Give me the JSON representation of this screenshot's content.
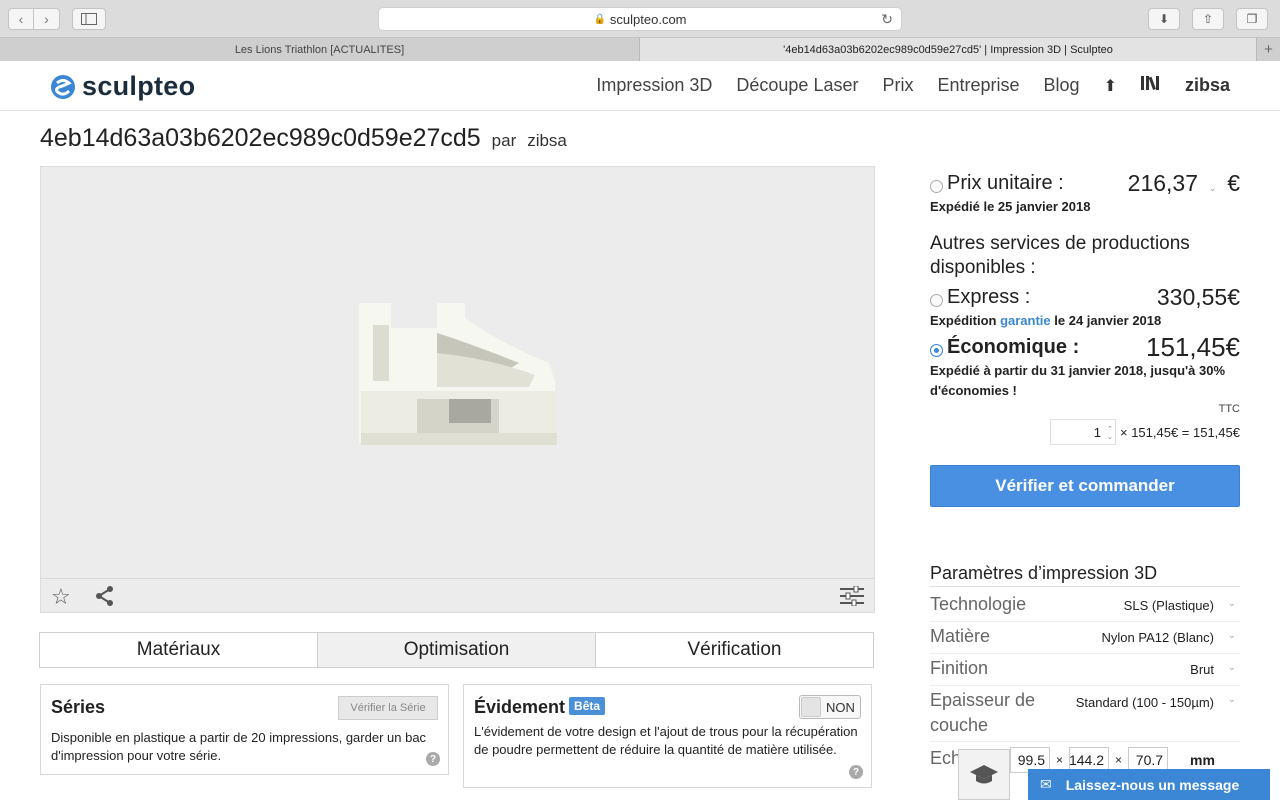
{
  "browser": {
    "url": "sculpteo.com",
    "tabs": [
      {
        "label": "Les Lions Triathlon [ACTUALITES]"
      },
      {
        "label": "'4eb14d63a03b6202ec989c0d59e27cd5' | Impression 3D | Sculpteo"
      }
    ]
  },
  "site": {
    "logo_text": "sculpteo",
    "brand_color": "#3b87d6",
    "nav": [
      "Impression 3D",
      "Découpe Laser",
      "Prix",
      "Entreprise",
      "Blog"
    ],
    "user": "zibsa"
  },
  "page": {
    "title": "4eb14d63a03b6202ec989c0d59e27cd5",
    "par": "par",
    "author": "zibsa"
  },
  "steps": [
    "Matériaux",
    "Optimisation",
    "Vérification"
  ],
  "series": {
    "title": "Séries",
    "button": "Vérifier la Série",
    "text": "Disponible en plastique a partir de 20 impressions, garder un bac d'impression pour votre série."
  },
  "evidement": {
    "title": "Évidement",
    "badge": "Bêta",
    "toggle": "NON",
    "text": "L'évidement de votre design et l'ajout de trous pour la récupération de poudre permettent de réduire la quantité de matière utilisée."
  },
  "pricing": {
    "unit_label": "Prix unitaire :",
    "unit_value": "216,37",
    "currency": "€",
    "unit_ship": "Expédié le 25 janvier 2018",
    "others_label": "Autres services de productions disponibles :",
    "express_label": "Express :",
    "express_value": "330,55€",
    "express_ship_a": "Expédition",
    "express_ship_link": "garantie",
    "express_ship_b": "le 24 janvier 2018",
    "eco_label": "Économique :",
    "eco_value": "151,45€",
    "eco_ship": "Expédié à partir du 31 janvier 2018, jusqu'à 30% d'économies !",
    "ttc": "TTC",
    "qty": "1",
    "qty_formula": "× 151,45€ = 151,45€",
    "order_button": "Vérifier et commander"
  },
  "params": {
    "title": "Paramètres d’impression 3D",
    "rows": [
      {
        "label": "Technologie",
        "value": "SLS (Plastique)"
      },
      {
        "label": "Matière",
        "value": "Nylon PA12 (Blanc)"
      },
      {
        "label": "Finition",
        "value": "Brut"
      },
      {
        "label": "Epaisseur de couche",
        "value": "Standard (100 - 150µm)"
      }
    ],
    "scale_label": "Echelle",
    "dims": [
      "99.5",
      "144.2",
      "70.7"
    ],
    "unit": "mm"
  },
  "chat": {
    "label": "Laissez-nous un message"
  }
}
